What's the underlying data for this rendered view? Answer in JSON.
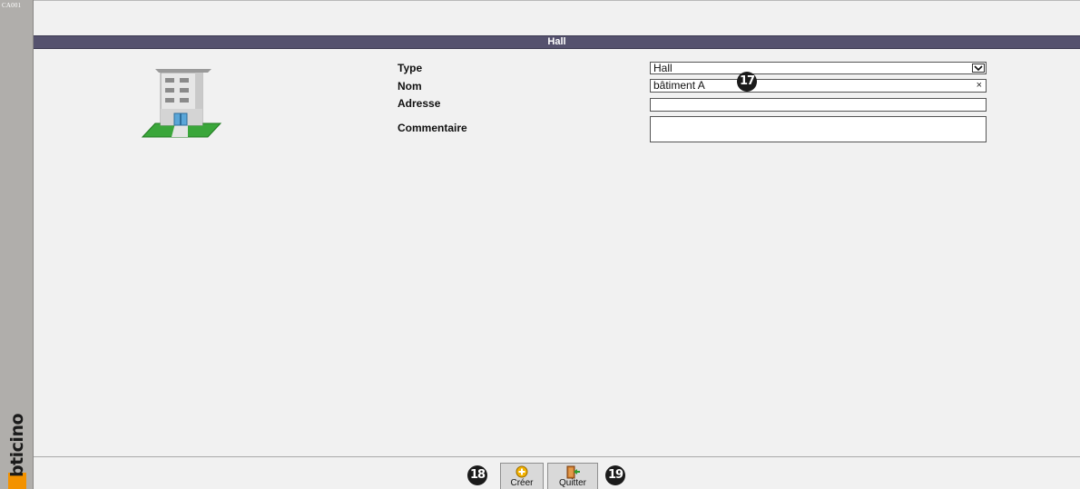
{
  "sidebar": {
    "screen_code": "CA001",
    "brand": "bticino"
  },
  "title_bar": {
    "title": "Hall"
  },
  "form": {
    "type": {
      "label": "Type",
      "value": "Hall"
    },
    "name": {
      "label": "Nom",
      "value": "bâtiment A"
    },
    "address": {
      "label": "Adresse",
      "value": ""
    },
    "comment": {
      "label": "Commentaire",
      "value": ""
    }
  },
  "toolbar": {
    "create_label": "Créer",
    "quit_label": "Quitter"
  },
  "markers": {
    "name_field": "17",
    "create": "18",
    "quit": "19"
  },
  "icons": {
    "building": "building-icon",
    "create": "plus-circle-icon",
    "quit": "exit-door-icon",
    "dropdown": "chevron-down-icon",
    "clear": "close-icon"
  },
  "colors": {
    "title_bar": "#55526e",
    "brand_orange": "#f39200",
    "sidebar": "#b0aeab",
    "background": "#f1f1f1"
  }
}
